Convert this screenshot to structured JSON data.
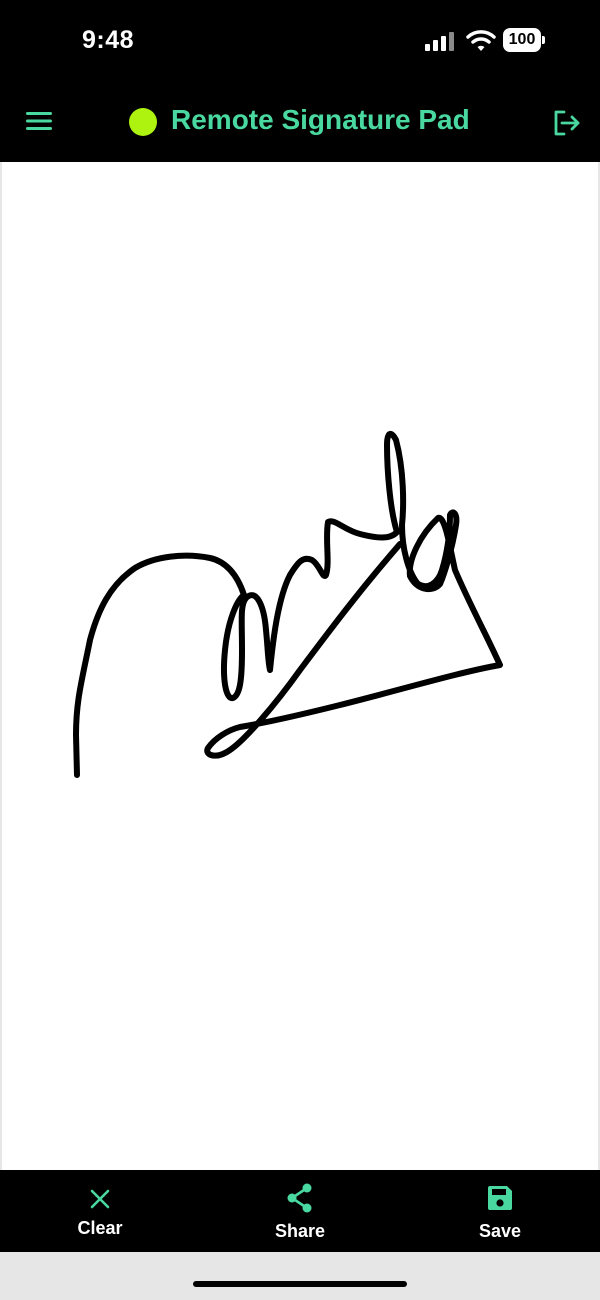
{
  "status_bar": {
    "time": "9:48",
    "battery": "100"
  },
  "header": {
    "title": "Remote Signature Pad"
  },
  "colors": {
    "accent": "#49d9a0",
    "status_dot": "#aef20f",
    "bar_background": "#000000",
    "canvas_background": "#ffffff",
    "ink": "#000000"
  },
  "icons": {
    "menu": "hamburger-menu-icon",
    "logout": "logout-icon",
    "clear": "close-x-icon",
    "share": "share-icon",
    "save": "floppy-disk-icon"
  },
  "toolbar": {
    "clear_label": "Clear",
    "share_label": "Share",
    "save_label": "Save"
  }
}
